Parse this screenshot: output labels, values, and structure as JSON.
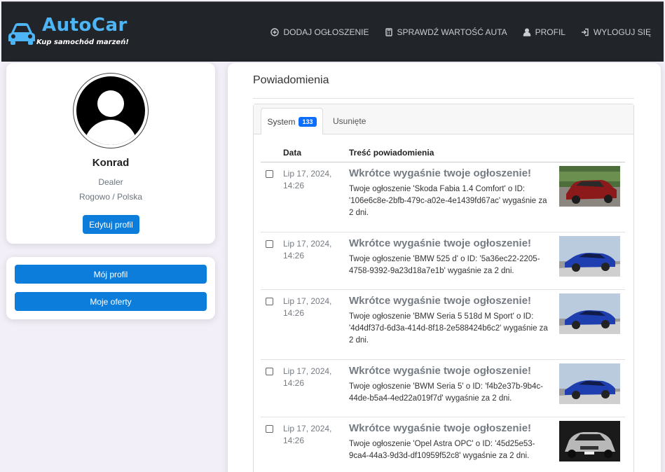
{
  "brand": {
    "title": "AutoCar",
    "tagline": "Kup samochód marzeń!"
  },
  "nav": [
    {
      "label": "DODAJ OGŁOSZENIE",
      "icon": "plus-circle-icon"
    },
    {
      "label": "SPRAWDŹ WARTOŚĆ AUTA",
      "icon": "calculator-icon"
    },
    {
      "label": "PROFIL",
      "icon": "person-icon"
    },
    {
      "label": "WYLOGUJ SIĘ",
      "icon": "logout-icon"
    }
  ],
  "profile": {
    "name": "Konrad",
    "role": "Dealer",
    "location": "Rogowo / Polska",
    "edit_label": "Edytuj profil"
  },
  "menu": {
    "my_profile": "Mój profil",
    "my_offers": "Moje oferty"
  },
  "main": {
    "title": "Powiadomienia",
    "tabs": {
      "system": "System",
      "system_count": "133",
      "deleted": "Usunięte"
    },
    "columns": {
      "date": "Data",
      "content": "Treść powiadomienia"
    }
  },
  "notifications": [
    {
      "date": "Lip 17, 2024, 14:26",
      "title": "Wkrótce wygaśnie twoje ogłoszenie!",
      "text": "Twoje ogłoszenie 'Skoda Fabia 1.4 Comfort' o ID: '106e6c8e-2bfb-479c-a02e-4e1439fd67ac' wygaśnie za 2 dni.",
      "thumb": "red-hatchback"
    },
    {
      "date": "Lip 17, 2024, 14:26",
      "title": "Wkrótce wygaśnie twoje ogłoszenie!",
      "text": "Twoje ogłoszenie 'BMW 525 d' o ID: '5a36ec22-2205-4758-9392-9a23d18a7e1b' wygaśnie za 2 dni.",
      "thumb": "blue-sedan"
    },
    {
      "date": "Lip 17, 2024, 14:26",
      "title": "Wkrótce wygaśnie twoje ogłoszenie!",
      "text": "Twoje ogłoszenie 'BMW Seria 5 518d M Sport' o ID: '4d4df37d-6d3a-414d-8f18-2e588424b6c2' wygaśnie za 2 dni.",
      "thumb": "blue-sedan"
    },
    {
      "date": "Lip 17, 2024, 14:26",
      "title": "Wkrótce wygaśnie twoje ogłoszenie!",
      "text": "Twoje ogłoszenie 'BWM Seria 5' o ID: 'f4b2e37b-9b4c-44de-b5a4-4ed22a019f7d' wygaśnie za 2 dni.",
      "thumb": "blue-sedan"
    },
    {
      "date": "Lip 17, 2024, 14:26",
      "title": "Wkrótce wygaśnie twoje ogłoszenie!",
      "text": "Twoje ogłoszenie 'Opel Astra OPC' o ID: '45d25e53-9ca4-44a3-9d3d-df10959f52c8' wygaśnie za 2 dni.",
      "thumb": "grey-hatchback"
    }
  ]
}
